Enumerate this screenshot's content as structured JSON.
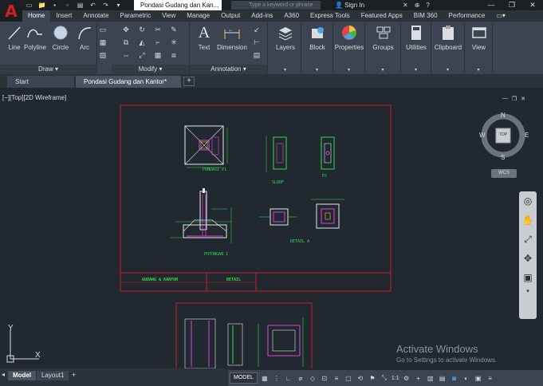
{
  "app": {
    "logo": "A",
    "document_title": "Pondasi Gudang dan Kan...",
    "search_placeholder": "Type a keyword or phrase",
    "sign_in": "Sign In",
    "window_controls": [
      "minimize-icon",
      "restore-icon",
      "close-icon"
    ]
  },
  "menu_tabs": [
    "Home",
    "Insert",
    "Annotate",
    "Parametric",
    "View",
    "Manage",
    "Output",
    "Add-ins",
    "A360",
    "Express Tools",
    "Featured Apps",
    "BIM 360",
    "Performance"
  ],
  "active_menu_tab": "Home",
  "ribbon": {
    "draw": {
      "label": "Draw ▾",
      "tools": [
        "Line",
        "Polyline",
        "Circle",
        "Arc"
      ]
    },
    "modify": {
      "label": "Modify ▾"
    },
    "annotation": {
      "label": "Annotation ▾",
      "tools": [
        "Text",
        "Dimension"
      ]
    },
    "panels": [
      "Layers",
      "Block",
      "Properties",
      "Groups",
      "Utilities",
      "Clipboard",
      "View"
    ]
  },
  "doc_tabs": {
    "start": "Start",
    "active": "Pondasi Gudang dan Kantor*",
    "plus": "+"
  },
  "viewport": {
    "label": "[−][Top][2D Wireframe]",
    "viewcube": {
      "top": "TOP",
      "n": "N",
      "s": "S",
      "e": "E",
      "w": "W",
      "wcs": "WCS"
    },
    "drawing": {
      "sheet_title": "GUDANG & KANTOR",
      "sheet_subtitle": "DETAIL",
      "labels": [
        "PONDASI P1",
        "SLOOF",
        "P2",
        "POTONGAN 1",
        "DETAIL A"
      ]
    }
  },
  "activate_windows": {
    "title": "Activate Windows",
    "subtitle": "Go to Settings to activate Windows."
  },
  "ucs": {
    "x": "X",
    "y": "Y"
  },
  "layout_tabs": [
    "Model",
    "Layout1"
  ],
  "active_layout_tab": "Model",
  "status": {
    "model_button": "MODEL",
    "scale": "1:1"
  },
  "colors": {
    "accent_red": "#d21f1f",
    "viewport_bg": "#212830",
    "ribbon_bg": "#3b4450",
    "drawing_green": "#29e04b",
    "drawing_magenta": "#e040e0",
    "drawing_red_frame": "#c81e28"
  }
}
